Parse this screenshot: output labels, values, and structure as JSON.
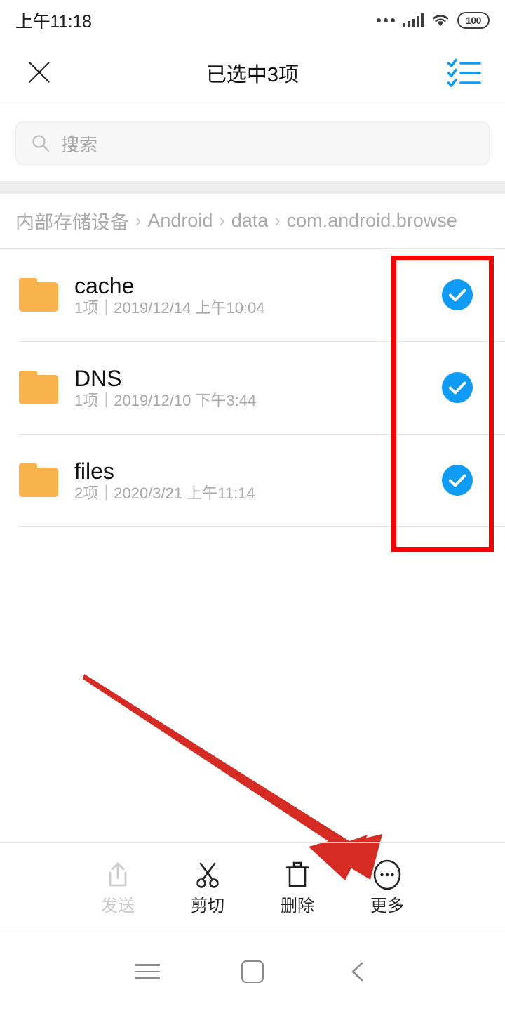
{
  "status_bar": {
    "time": "上午11:18",
    "battery_level": "100",
    "icons": [
      "more-dots-icon",
      "signal-icon",
      "wifi-icon",
      "battery-icon"
    ]
  },
  "title_bar": {
    "close_label": "close-icon",
    "title": "已选中3项",
    "select_all_label": "select-all-icon",
    "accent_color": "#0d9bf5"
  },
  "search": {
    "placeholder": "搜索",
    "icon": "search-icon"
  },
  "breadcrumb": {
    "separator": "›",
    "items": [
      "内部存储设备",
      "Android",
      "data",
      "com.android.browse"
    ]
  },
  "file_list": {
    "rows": [
      {
        "name": "cache",
        "meta": "1项｜2019/12/14 上午10:04",
        "icon": "folder-icon",
        "selected": true
      },
      {
        "name": "DNS",
        "meta": "1项｜2019/12/10 下午3:44",
        "icon": "folder-icon",
        "selected": true
      },
      {
        "name": "files",
        "meta": "2项｜2020/3/21 上午11:14",
        "icon": "folder-icon",
        "selected": true
      }
    ],
    "folder_color": "#f9b34c",
    "check_color": "#0d9bf5"
  },
  "annotations": {
    "highlight_color": "#fb0000",
    "box_target": "selection-checkmarks-column",
    "arrow_target": "更多"
  },
  "toolbar": {
    "items": [
      {
        "label": "发送",
        "icon": "share-icon",
        "disabled": true
      },
      {
        "label": "剪切",
        "icon": "scissors-icon",
        "disabled": false
      },
      {
        "label": "删除",
        "icon": "trash-icon",
        "disabled": false
      },
      {
        "label": "更多",
        "icon": "more-circle-icon",
        "disabled": false
      }
    ]
  },
  "nav_bar": {
    "items": [
      {
        "name": "menu-icon"
      },
      {
        "name": "home-icon"
      },
      {
        "name": "back-icon"
      }
    ]
  }
}
